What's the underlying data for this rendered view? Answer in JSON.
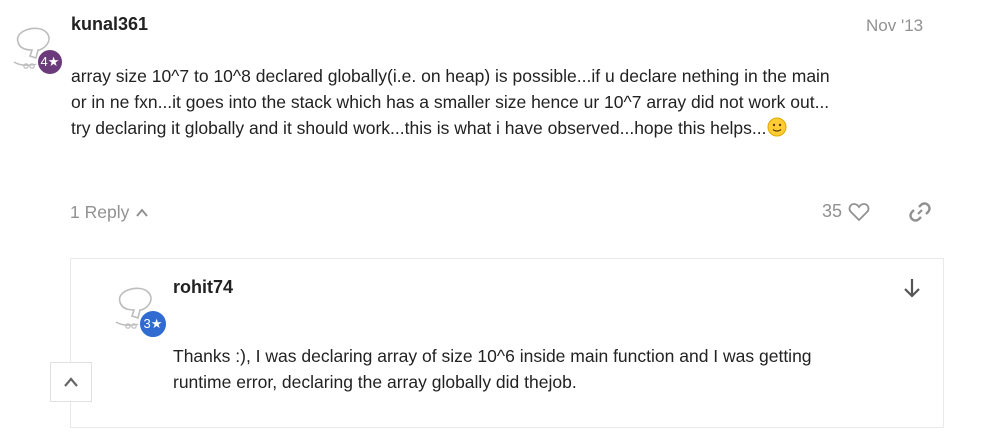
{
  "post": {
    "username": "kunal361",
    "date": "Nov '13",
    "badge": "4★",
    "badge_color": "#6b3a7a",
    "text_lines": [
      "array size 10^7 to 10^8 declared globally(i.e. on heap) is possible...if u declare nething in the main",
      "or in ne fxn...it goes into the stack which has a smaller size hence ur 10^7 array did not work out...",
      "try declaring it globally and it should work...this is what i have observed...hope this helps..."
    ],
    "replies_label": "1 Reply",
    "like_count": "35"
  },
  "reply": {
    "username": "rohit74",
    "badge": "3★",
    "badge_color": "#2f6bd0",
    "text_lines": [
      "Thanks :), I was declaring array of size 10^6 inside main function and I was getting",
      "runtime error, declaring the array globally did thejob."
    ]
  },
  "icons": {
    "avatar": "default-avatar-icon",
    "chevron_up": "chevron-up-icon",
    "heart": "heart-icon",
    "link": "link-icon",
    "arrow_down": "arrow-down-icon",
    "emoji": "slightly-smiling-face-icon"
  }
}
